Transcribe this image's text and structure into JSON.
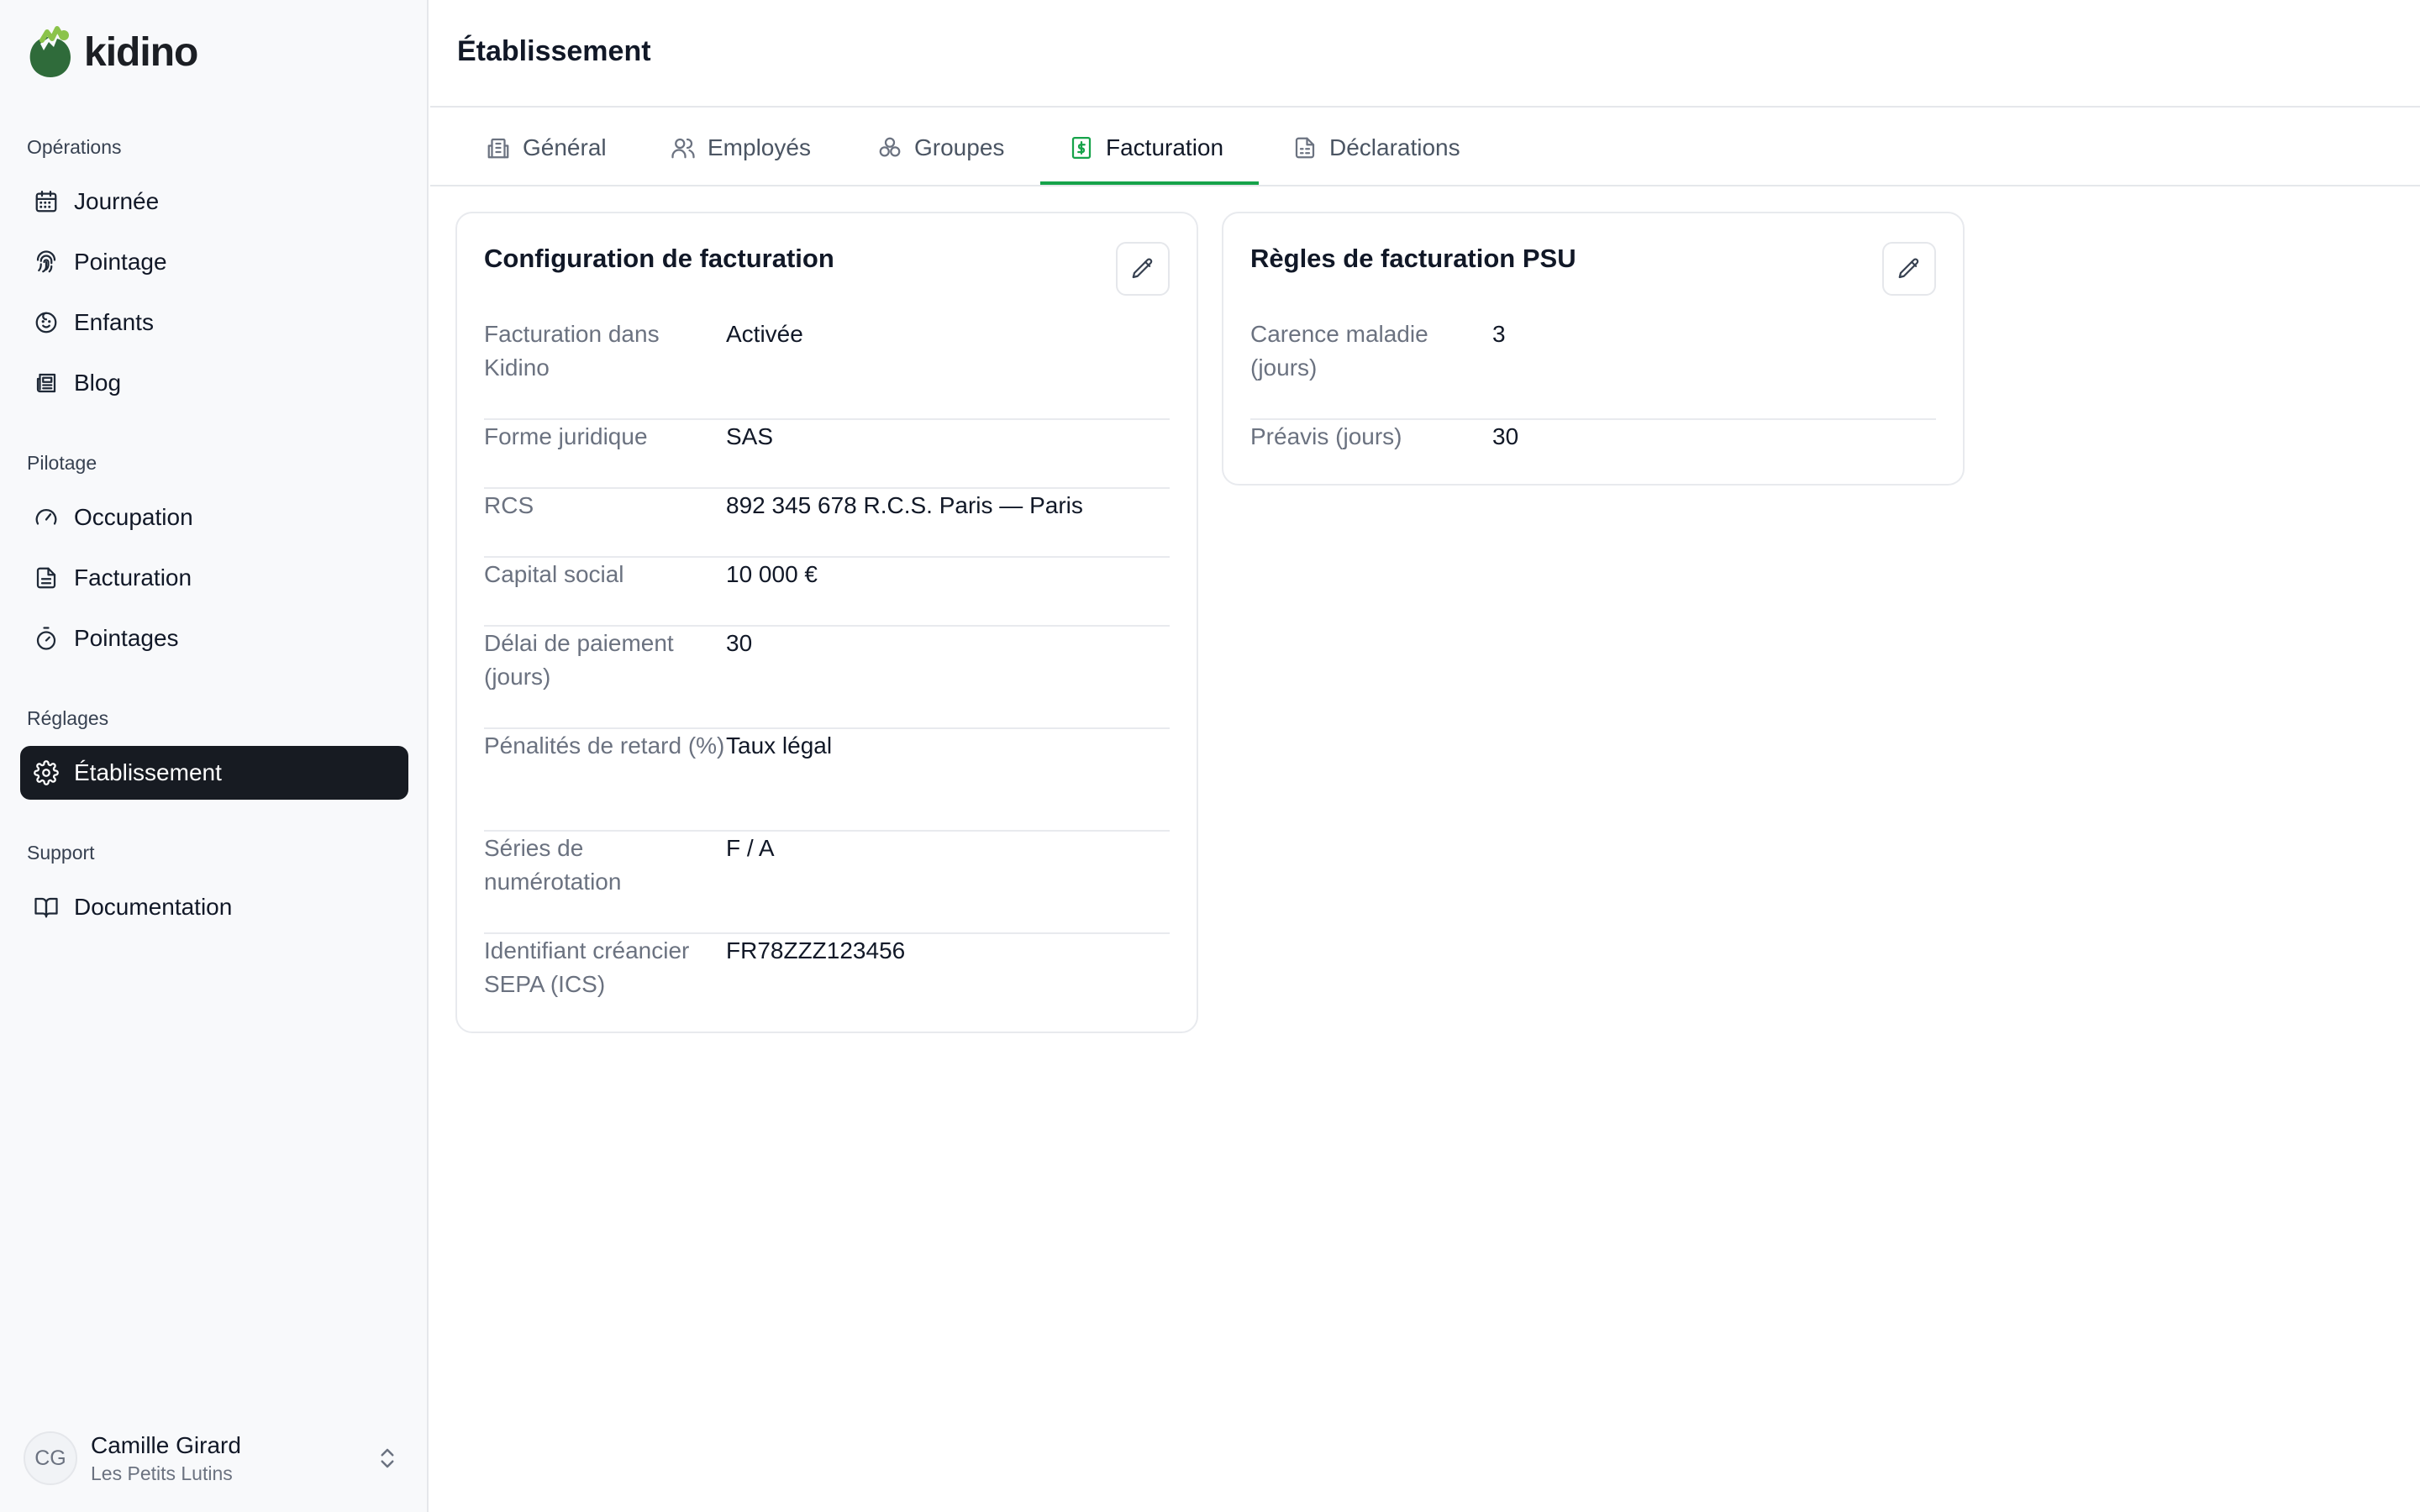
{
  "brand": {
    "name": "kidino"
  },
  "sidebar": {
    "sections": [
      {
        "title": "Opérations",
        "items": [
          {
            "label": "Journée",
            "icon": "calendar-icon"
          },
          {
            "label": "Pointage",
            "icon": "fingerprint-icon"
          },
          {
            "label": "Enfants",
            "icon": "baby-face-icon"
          },
          {
            "label": "Blog",
            "icon": "newspaper-icon"
          }
        ]
      },
      {
        "title": "Pilotage",
        "items": [
          {
            "label": "Occupation",
            "icon": "gauge-icon"
          },
          {
            "label": "Facturation",
            "icon": "document-icon"
          },
          {
            "label": "Pointages",
            "icon": "stopwatch-icon"
          }
        ]
      },
      {
        "title": "Réglages",
        "items": [
          {
            "label": "Établissement",
            "icon": "gear-icon",
            "active": true
          }
        ]
      },
      {
        "title": "Support",
        "items": [
          {
            "label": "Documentation",
            "icon": "book-icon"
          }
        ]
      }
    ]
  },
  "user": {
    "initials": "CG",
    "name": "Camille Girard",
    "org": "Les Petits Lutins"
  },
  "header": {
    "title": "Établissement"
  },
  "tabs": [
    {
      "label": "Général",
      "icon": "building-icon"
    },
    {
      "label": "Employés",
      "icon": "users-icon"
    },
    {
      "label": "Groupes",
      "icon": "groups-icon"
    },
    {
      "label": "Facturation",
      "icon": "dollar-document-icon",
      "active": true
    },
    {
      "label": "Déclarations",
      "icon": "file-icon"
    }
  ],
  "billing_config": {
    "title": "Configuration de facturation",
    "rows": [
      {
        "label": "Facturation dans Kidino",
        "value": "Activée"
      },
      {
        "label": "Forme juridique",
        "value": "SAS"
      },
      {
        "label": "RCS",
        "value": "892 345 678 R.C.S. Paris — Paris"
      },
      {
        "label": "Capital social",
        "value": "10 000 €"
      },
      {
        "label": "Délai de paiement (jours)",
        "value": "30"
      },
      {
        "label": "Pénalités de retard (%)",
        "value": "Taux légal"
      },
      {
        "label": "Séries de numérotation",
        "value": "F / A"
      },
      {
        "label": "Identifiant créancier SEPA (ICS)",
        "value": "FR78ZZZ123456"
      }
    ]
  },
  "psu_rules": {
    "title": "Règles de facturation PSU",
    "rows": [
      {
        "label": "Carence maladie (jours)",
        "value": "3"
      },
      {
        "label": "Préavis (jours)",
        "value": "30"
      }
    ]
  },
  "colors": {
    "accent": "#16a34a",
    "active_nav": "#171b22",
    "logo_dark": "#2f6b3a",
    "logo_light": "#8bc34a"
  }
}
